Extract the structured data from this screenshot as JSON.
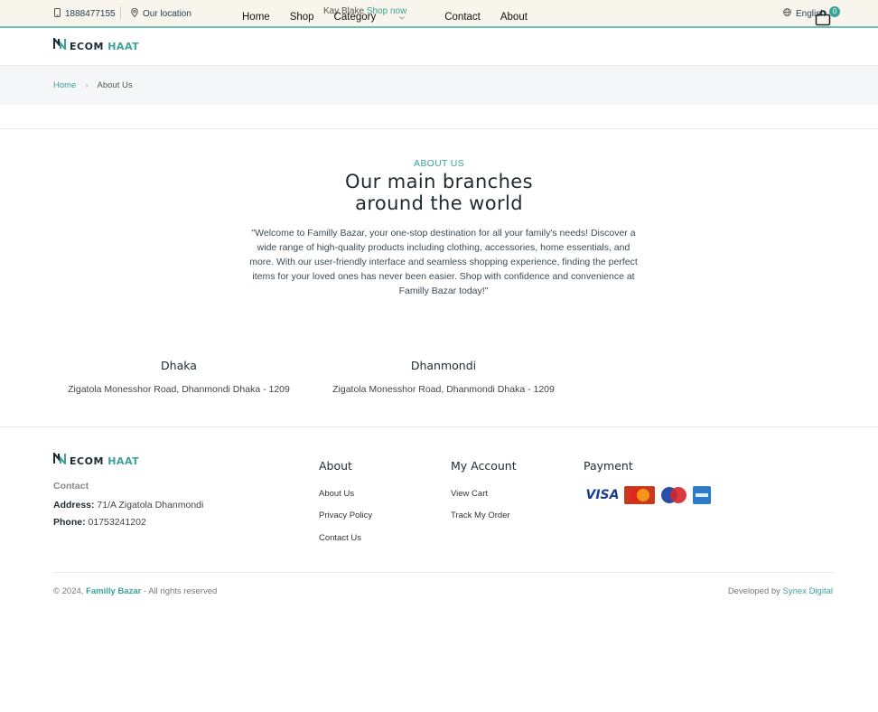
{
  "topbar": {
    "phone": "1888477155",
    "location": "Our location",
    "promo_text": "Kay Blake",
    "promo_link": "Shop now",
    "language": "English"
  },
  "header": {
    "logo_part1": "ECOM ",
    "logo_part2": "HAAT",
    "nav": [
      "Home",
      "Shop",
      "Category",
      "Contact",
      "About"
    ],
    "cart_count": "0"
  },
  "breadcrumb": {
    "home": "Home",
    "current": "About Us"
  },
  "about": {
    "eyebrow": "ABOUT US",
    "heading_line1": "Our main branches",
    "heading_line2": "around the world",
    "description": "\"Welcome to Familly Bazar, your one-stop destination for all your family's needs! Discover a wide range of high-quality products including clothing, accessories, home essentials, and more. With our user-friendly interface and seamless shopping experience, finding the perfect items for your loved ones has never been easier. Shop with confidence and convenience at Familly Bazar today!\""
  },
  "branches": [
    {
      "name": "Dhaka",
      "address": "Zigatola Monesshor Road, Dhanmondi Dhaka - 1209"
    },
    {
      "name": "Dhanmondi",
      "address": "Zigatola Monesshor Road, Dhanmondi Dhaka - 1209"
    }
  ],
  "footer": {
    "logo_part1": "ECOM ",
    "logo_part2": "HAAT",
    "contact_title": "Contact",
    "address_label": "Address:",
    "address_value": " 71/A Zigatola Dhanmondi",
    "phone_label": "Phone:",
    "phone_value": " 01753241202",
    "about_title": "About",
    "about_links": [
      "About Us",
      "Privacy Policy",
      "Contact Us"
    ],
    "account_title": "My Account",
    "account_links": [
      "View Cart",
      "Track My Order"
    ],
    "payment_title": "Payment",
    "payments": [
      "VISA",
      "MasterCard",
      "Maestro",
      "AMEX"
    ],
    "copyright_prefix": "© 2024, ",
    "copyright_brand": "Familly Bazar",
    "copyright_suffix": " - All rights reserved",
    "developed_prefix": "Developed by ",
    "developed_brand": "Synex Digital"
  },
  "colors": {
    "accent": "#3aa39a",
    "topbar_bg": "#f8f6ec",
    "breadcrumb_bg": "#f5f6f8"
  }
}
